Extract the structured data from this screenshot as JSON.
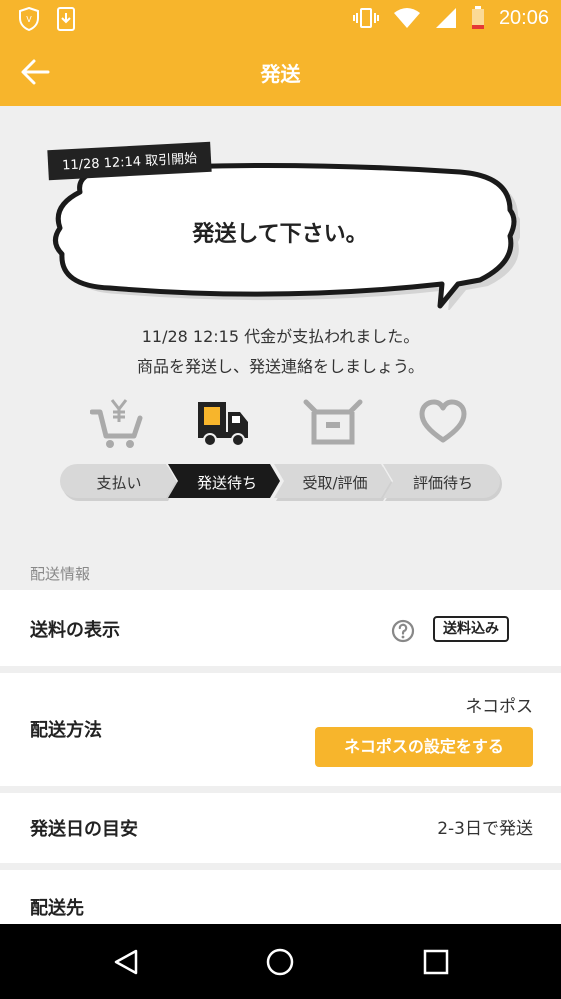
{
  "status_bar": {
    "time": "20:06",
    "icons": [
      "shield-icon",
      "download-icon",
      "vibrate-icon",
      "wifi-icon",
      "signal-icon",
      "battery-icon"
    ]
  },
  "header": {
    "title": "発送",
    "back_icon": "back-arrow-icon"
  },
  "bubble": {
    "tag": "11/28 12:14 取引開始",
    "text": "発送して下さい。"
  },
  "message": {
    "line1": "11/28 12:15 代金が支払われました。",
    "line2": "商品を発送し、発送連絡をしましょう。"
  },
  "steps": [
    {
      "label": "支払い",
      "icon": "cart-yen-icon",
      "active": false
    },
    {
      "label": "発送待ち",
      "icon": "truck-icon",
      "active": true
    },
    {
      "label": "受取/評価",
      "icon": "box-icon",
      "active": false
    },
    {
      "label": "評価待ち",
      "icon": "heart-icon",
      "active": false
    }
  ],
  "shipping": {
    "section_label": "配送情報",
    "fee": {
      "label": "送料の表示",
      "badge": "送料込み",
      "icon": "help-icon"
    },
    "method": {
      "label": "配送方法",
      "value": "ネコポス",
      "button": "ネコポスの設定をする"
    },
    "ship_date": {
      "label": "発送日の目安",
      "value": "2-3日で発送"
    },
    "destination": {
      "label": "配送先"
    }
  },
  "colors": {
    "brand": "#f7b52c",
    "dark": "#222222",
    "background": "#efefef"
  },
  "nav_icons": [
    "back-triangle-icon",
    "home-circle-icon",
    "recents-square-icon"
  ]
}
